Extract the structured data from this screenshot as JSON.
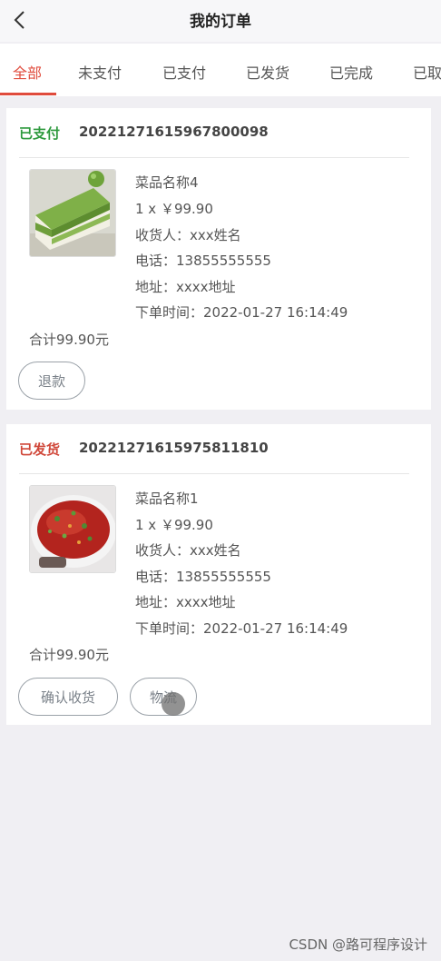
{
  "header": {
    "title": "我的订单",
    "back_icon": "chevron-left-icon"
  },
  "tabs": [
    {
      "label": "全部",
      "active": true
    },
    {
      "label": "未支付",
      "active": false
    },
    {
      "label": "已支付",
      "active": false
    },
    {
      "label": "已发货",
      "active": false
    },
    {
      "label": "已完成",
      "active": false
    },
    {
      "label": "已取",
      "active": false
    }
  ],
  "colors": {
    "accent": "#e04b3c",
    "paid": "#2e9a3e",
    "shipped": "#d0483a"
  },
  "orders": [
    {
      "status": "已支付",
      "status_color": "#2e9a3e",
      "order_no": "20221271615967800098",
      "image": "green-cake-photo",
      "dish": "菜品名称4",
      "qty_price": "1 x ￥99.90",
      "receiver": "收货人：xxx姓名",
      "phone": "电话：13855555555",
      "address": "地址：xxxx地址",
      "order_time": "下单时间：2022-01-27 16:14:49",
      "total": "合计99.90元",
      "buttons": [
        "退款"
      ]
    },
    {
      "status": "已发货",
      "status_color": "#d0483a",
      "order_no": "20221271615975811810",
      "image": "spicy-fish-photo",
      "dish": "菜品名称1",
      "qty_price": "1 x ￥99.90",
      "receiver": "收货人：xxx姓名",
      "phone": "电话：13855555555",
      "address": "地址：xxxx地址",
      "order_time": "下单时间：2022-01-27 16:14:49",
      "total": "合计99.90元",
      "buttons": [
        "确认收货",
        "物流"
      ]
    }
  ],
  "watermark": "CSDN @路可程序设计"
}
